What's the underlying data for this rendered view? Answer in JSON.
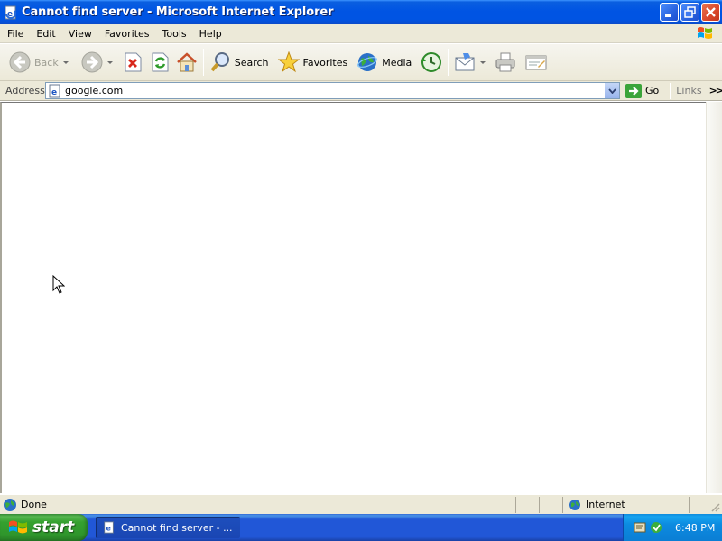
{
  "window": {
    "title": "Cannot find server - Microsoft Internet Explorer"
  },
  "menu": {
    "items": [
      "File",
      "Edit",
      "View",
      "Favorites",
      "Tools",
      "Help"
    ]
  },
  "toolbar": {
    "back_label": "Back",
    "search_label": "Search",
    "favorites_label": "Favorites",
    "media_label": "Media"
  },
  "address": {
    "label": "Address",
    "value": "google.com",
    "go_label": "Go",
    "links_label": "Links"
  },
  "status": {
    "text": "Done",
    "zone": "Internet"
  },
  "taskbar": {
    "start_label": "start",
    "task_label": "Cannot find server - ...",
    "clock": "6:48 PM"
  },
  "colors": {
    "titlebar_blue": "#0054e3",
    "chrome_beige": "#ece9d8",
    "start_green": "#35a12f",
    "tray_blue": "#0c8ae0"
  }
}
